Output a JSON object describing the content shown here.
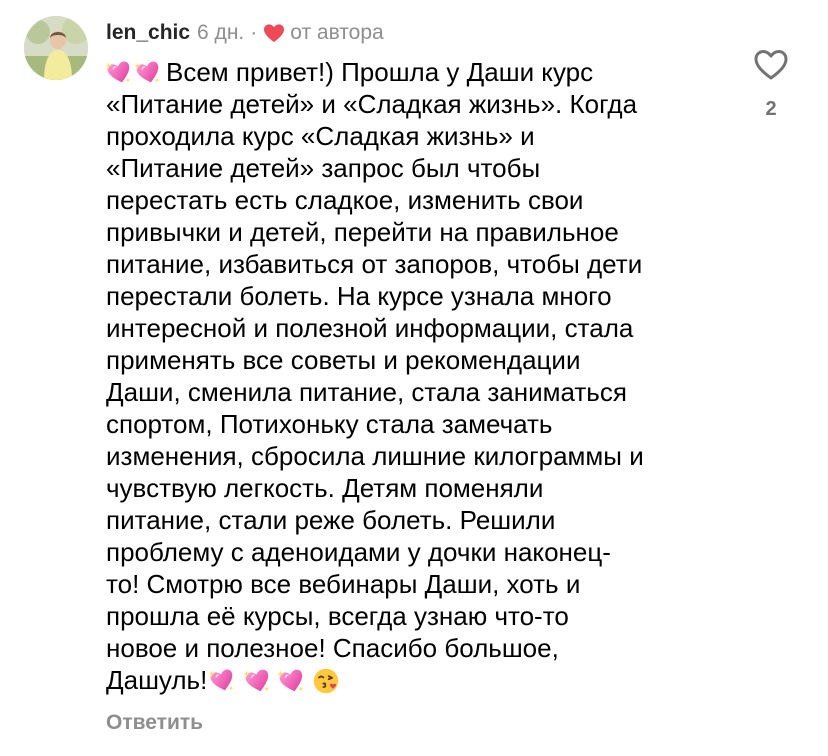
{
  "comment": {
    "username": "len_chic",
    "time": "6 дн.",
    "separator": "·",
    "author_label": "от автора",
    "lines": [
      "Всем привет!) Прошла у Даши курс",
      "«Питание детей» и «Сладкая жизнь». Когда",
      "проходила курс «Сладкая жизнь» и",
      "«Питание детей» запрос был чтобы",
      "перестать есть сладкое, изменить свои",
      "привычки и детей, перейти на правильное",
      "питание, избавиться от запоров, чтобы дети",
      "перестали болеть. На курсе узнала много",
      "интересной и полезной информации, стала",
      "применять все советы и рекомендации",
      "Даши, сменила питание, стала заниматься",
      "спортом, Потихоньку стала замечать",
      "изменения, сбросила лишние килограммы и",
      "чувствую легкость. Детям поменяли",
      "питание, стали реже болеть. Решили",
      "проблему с аденоидами у дочки наконец-",
      "то! Смотрю все вебинары Даши, хоть и",
      "прошла её курсы, всегда узнаю что-то",
      "новое и полезное! Спасибо большое,",
      "Дашуль!"
    ],
    "reply_label": "Ответить",
    "like_count": "2",
    "icons": {
      "leading_emoji": "sparkling-heart-icon",
      "trailing_emoji": [
        "sparkling-heart-icon",
        "sparkling-heart-icon",
        "sparkling-heart-icon",
        "face-blowing-kiss-icon"
      ],
      "like": "heart-outline-icon",
      "author_badge": "red-heart-icon"
    },
    "colors": {
      "author_heart": "#ED4956",
      "secondary_text": "#8E8E8E"
    }
  }
}
